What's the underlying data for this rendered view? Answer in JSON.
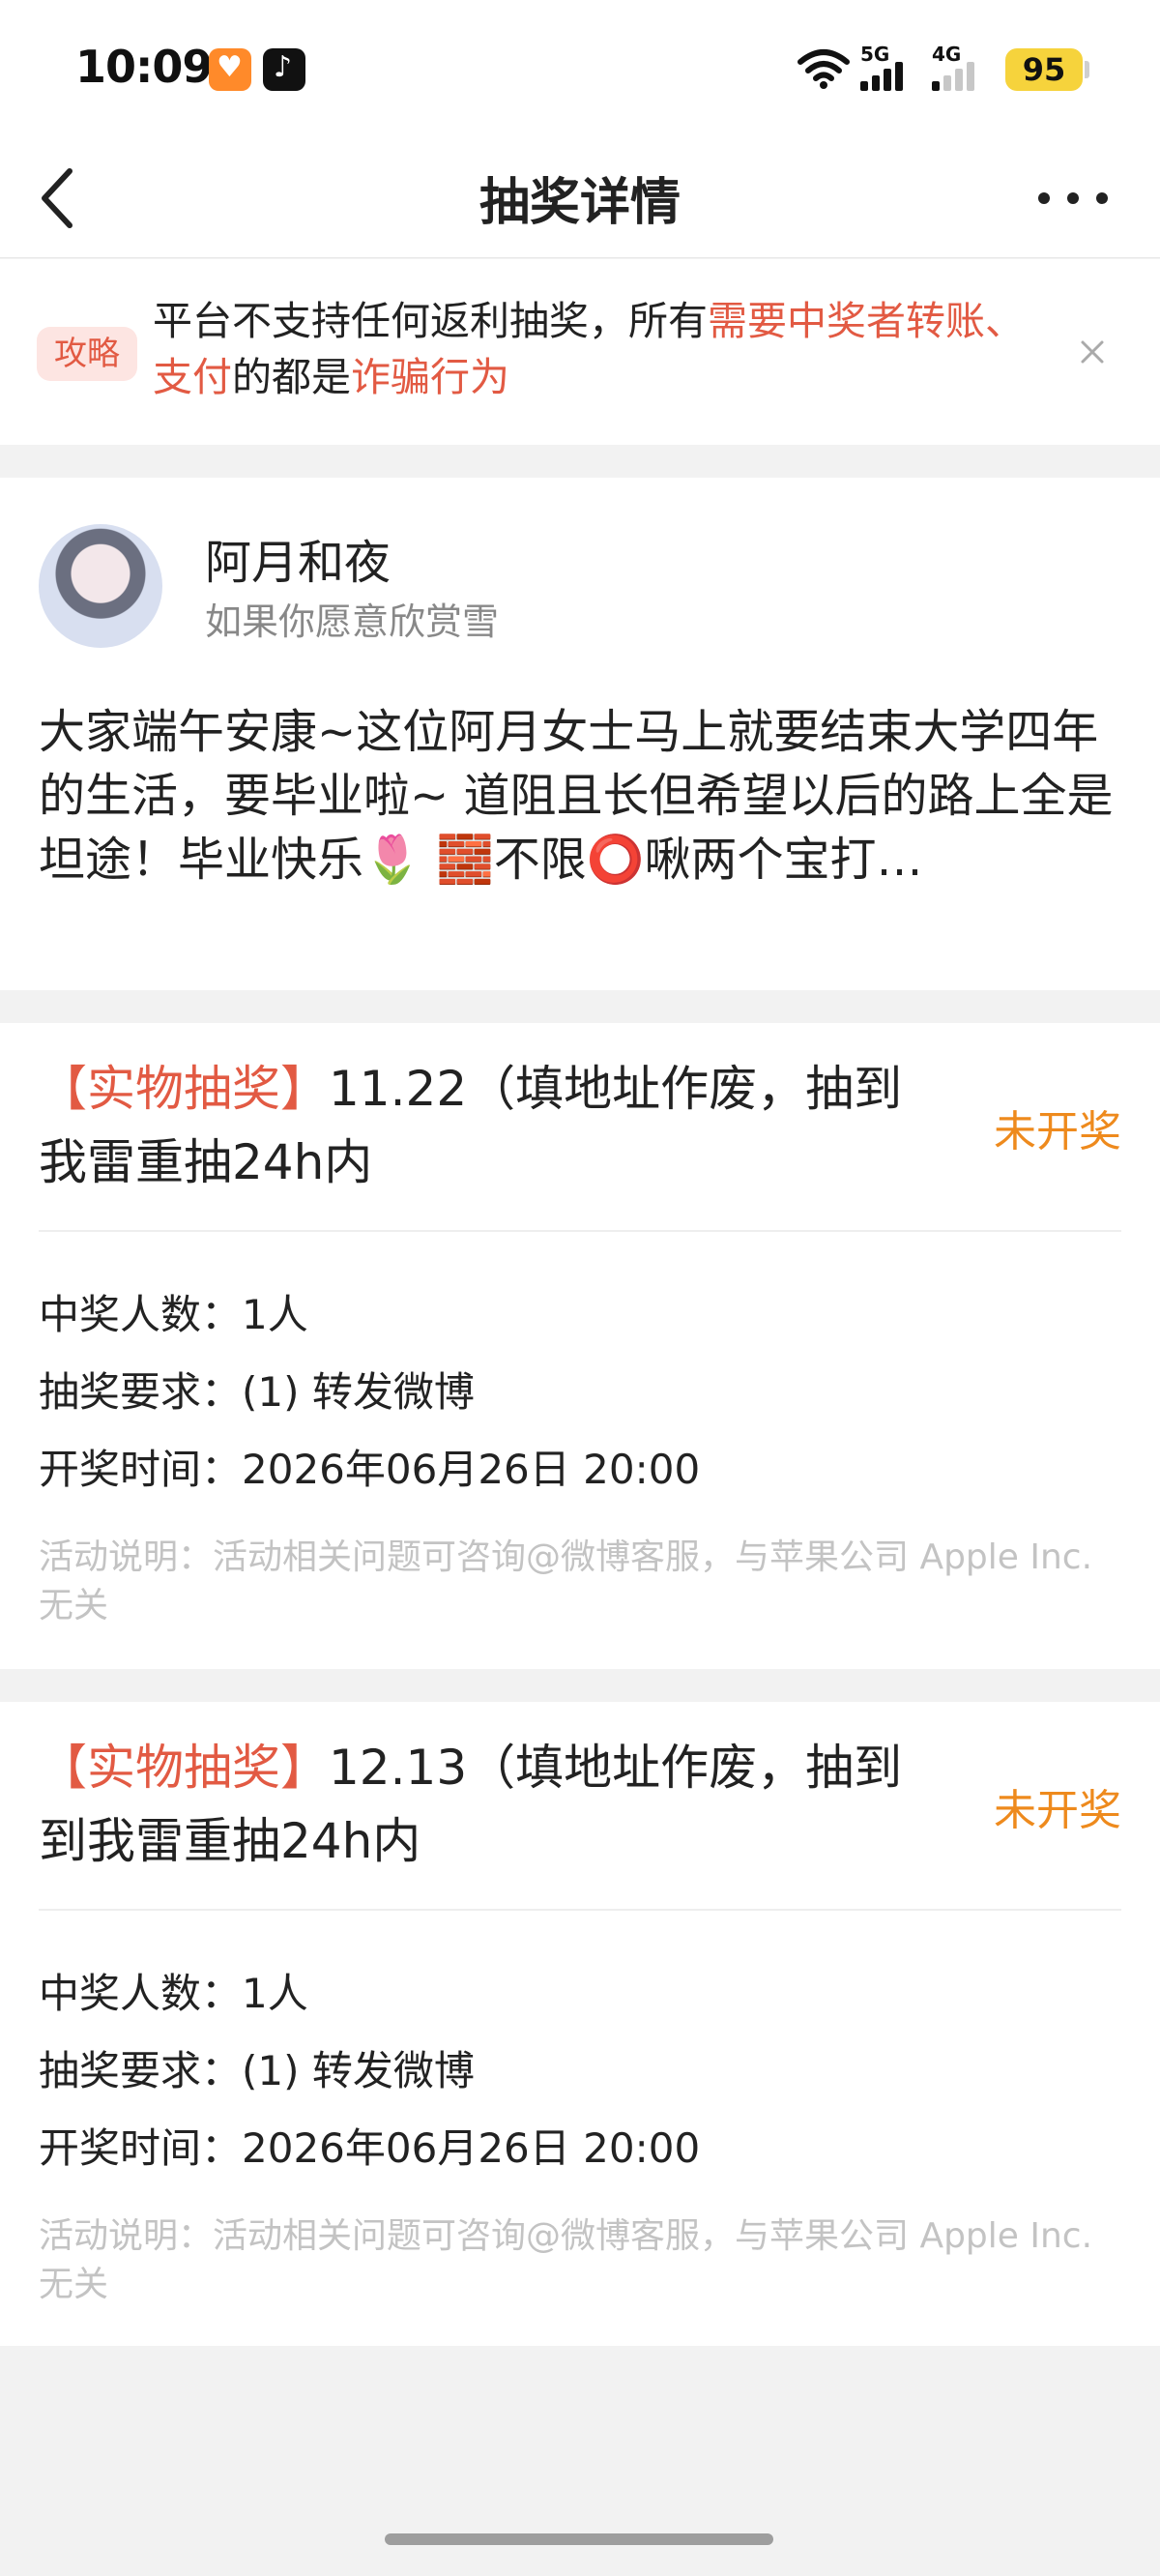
{
  "status_bar": {
    "time": "10:09",
    "network_5g": "5G",
    "network_4g": "4G",
    "battery": "95",
    "apps": [
      "heart-app-icon",
      "tiktok-icon"
    ],
    "battery_color": "#f6d33c"
  },
  "nav": {
    "title": "抽奖详情",
    "back_icon": "chevron-left-icon",
    "more_icon": "more-dots-icon"
  },
  "tip": {
    "badge": "攻略",
    "text_1": "平台不支持任何返利抽奖，所有",
    "highlight_1": "需要中奖者转账、支付",
    "text_2": "的都是",
    "highlight_2": "诈骗行为",
    "close_icon": "close-icon",
    "highlight_color": "#e25a43"
  },
  "post": {
    "author": "阿月和夜",
    "subtitle": "如果你愿意欣赏雪",
    "content": "大家端午安康~这位阿月女士马上就要结束大学四年的生活，要毕业啦~ 道阻且长但希望以后的路上全是坦途！毕业快乐🌷 🧱不限⭕啾两个宝打…"
  },
  "lotteries": [
    {
      "tag": "【实物抽奖】",
      "title": "11.22（填地址作废，抽到我雷重抽24h内",
      "status": "未开奖",
      "winners": "中奖人数：1人",
      "requirement": "抽奖要求：(1) 转发微博",
      "draw_time": "开奖时间：2026年06月26日 20:00",
      "note": "活动说明：活动相关问题可咨询@微博客服，与苹果公司 Apple Inc. 无关"
    },
    {
      "tag": "【实物抽奖】",
      "title": "12.13（填地址作废，抽到到我雷重抽24h内",
      "status": "未开奖",
      "winners": "中奖人数：1人",
      "requirement": "抽奖要求：(1) 转发微博",
      "draw_time": "开奖时间：2026年06月26日 20:00",
      "note": "活动说明：活动相关问题可咨询@微博客服，与苹果公司 Apple Inc. 无关"
    }
  ],
  "colors": {
    "accent_red": "#e25a43",
    "status_orange": "#ee8a1d",
    "background": "#f2f2f2"
  }
}
